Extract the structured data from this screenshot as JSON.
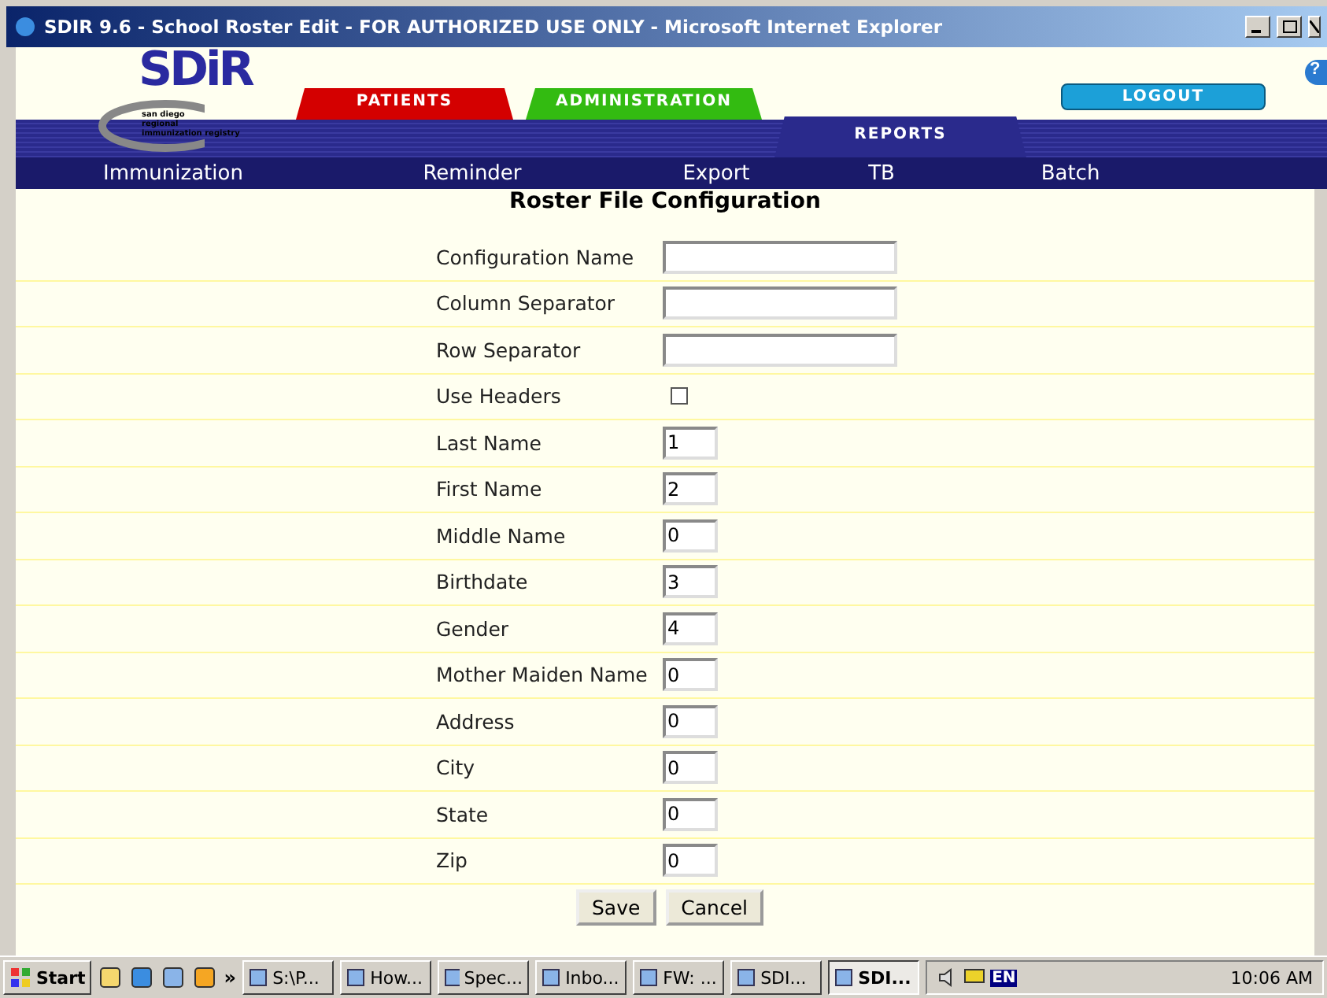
{
  "window": {
    "title": "SDIR 9.6 - School Roster Edit - FOR AUTHORIZED USE ONLY - Microsoft Internet Explorer"
  },
  "logo": {
    "text": "SDiR",
    "tagline": [
      "san diego",
      "regional",
      "immunization registry"
    ]
  },
  "tabs": [
    {
      "label": "PATIENTS",
      "color": "#d40000",
      "selected": false
    },
    {
      "label": "ADMINISTRATION",
      "color": "#33bb11",
      "selected": false
    },
    {
      "label": "REPORTS",
      "color": "#2a2a8c",
      "selected": true
    }
  ],
  "logout": {
    "label": "LOGOUT"
  },
  "help": {
    "label": "?"
  },
  "nav": [
    "Immunization",
    "Reminder",
    "Export",
    "TB",
    "Batch"
  ],
  "form": {
    "title": "Roster File Configuration",
    "fields": [
      {
        "kind": "text",
        "label": "Configuration Name"
      },
      {
        "kind": "text",
        "label": "Column Separator"
      },
      {
        "kind": "text",
        "label": "Row Separator"
      },
      {
        "kind": "checkbox",
        "label": "Use Headers",
        "checked": false
      },
      {
        "kind": "number",
        "label": "Last Name",
        "value": "1"
      },
      {
        "kind": "number",
        "label": "First Name",
        "value": "2"
      },
      {
        "kind": "number",
        "label": "Middle Name",
        "value": "0"
      },
      {
        "kind": "number",
        "label": "Birthdate",
        "value": "3"
      },
      {
        "kind": "number",
        "label": "Gender",
        "value": "4"
      },
      {
        "kind": "number",
        "label": "Mother Maiden Name",
        "value": "0"
      },
      {
        "kind": "number",
        "label": "Address",
        "value": "0"
      },
      {
        "kind": "number",
        "label": "City",
        "value": "0"
      },
      {
        "kind": "number",
        "label": "State",
        "value": "0"
      },
      {
        "kind": "number",
        "label": "Zip",
        "value": "0"
      }
    ],
    "buttons": [
      "Save",
      "Cancel"
    ]
  },
  "taskbar": {
    "start": "Start",
    "more": "»",
    "tasks": [
      {
        "label": "S:\\P...",
        "selected": false
      },
      {
        "label": "How...",
        "selected": false
      },
      {
        "label": "Spec...",
        "selected": false
      },
      {
        "label": "Inbo...",
        "selected": false
      },
      {
        "label": "FW: ...",
        "selected": false
      },
      {
        "label": "SDI...",
        "selected": false
      },
      {
        "label": "SDI...",
        "selected": true
      }
    ],
    "language": "EN",
    "clock": "10:06 AM"
  }
}
